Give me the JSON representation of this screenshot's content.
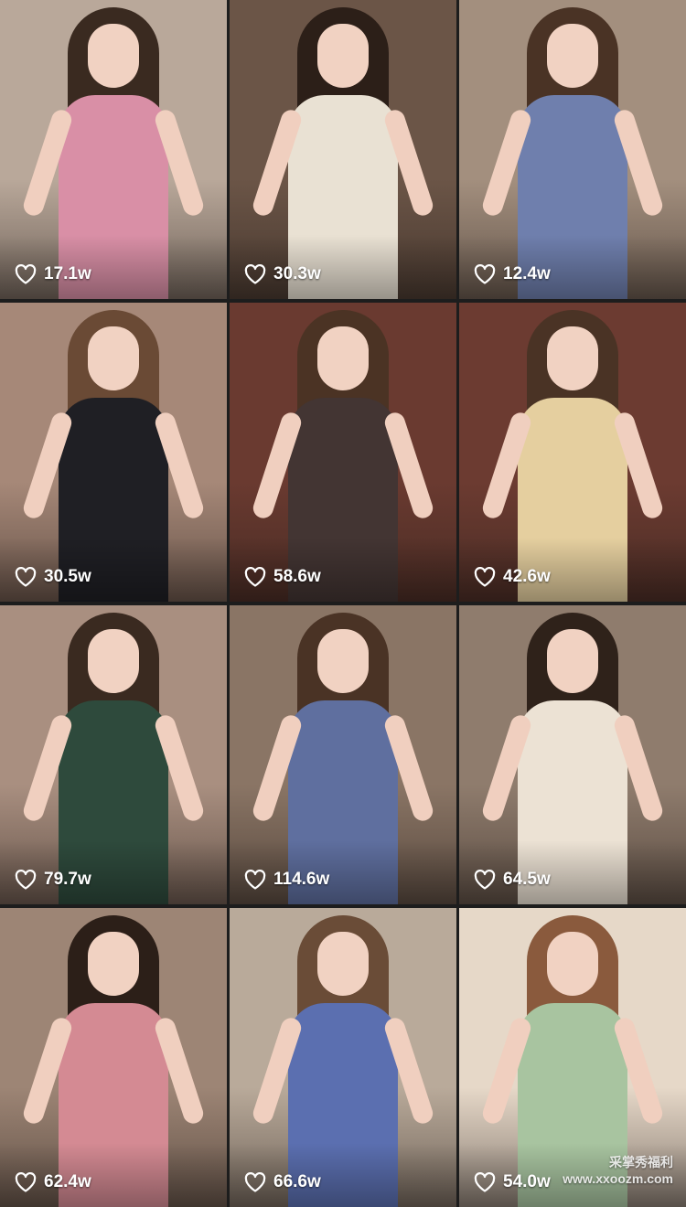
{
  "videos": [
    {
      "likes": "17.1w",
      "bg": "#b9a89a",
      "dress": "#d98fa6",
      "hair": "#3a2a20"
    },
    {
      "likes": "30.3w",
      "bg": "#6b5547",
      "dress": "#e9e1d3",
      "hair": "#2c1f18"
    },
    {
      "likes": "12.4w",
      "bg": "#a38f7e",
      "dress": "#6f7fad",
      "hair": "#4a3325"
    },
    {
      "likes": "30.5w",
      "bg": "#a68878",
      "dress": "#1f1f24",
      "hair": "#6a4a35"
    },
    {
      "likes": "58.6w",
      "bg": "#6a3a30",
      "dress": "#433533",
      "hair": "#4b3324"
    },
    {
      "likes": "42.6w",
      "bg": "#6c3b31",
      "dress": "#e5cf9f",
      "hair": "#4a3325"
    },
    {
      "likes": "79.7w",
      "bg": "#a98f80",
      "dress": "#2e4a3c",
      "hair": "#3a2a20"
    },
    {
      "likes": "114.6w",
      "bg": "#8a7565",
      "dress": "#5f6f9f",
      "hair": "#4a3325"
    },
    {
      "likes": "64.5w",
      "bg": "#8f7c6d",
      "dress": "#ece2d4",
      "hair": "#2f221a"
    },
    {
      "likes": "62.4w",
      "bg": "#9d8575",
      "dress": "#d48a93",
      "hair": "#2c1f18"
    },
    {
      "likes": "66.6w",
      "bg": "#b9aa9a",
      "dress": "#5b6fb0",
      "hair": "#6a4c37"
    },
    {
      "likes": "54.0w",
      "bg": "#e6d8c8",
      "dress": "#a8c4a0",
      "hair": "#8a5a3d"
    }
  ],
  "watermark": {
    "line1": "采掌秀福利",
    "line2": "www.xxoozm.com"
  },
  "icons": {
    "like": "heart-outline-icon"
  }
}
